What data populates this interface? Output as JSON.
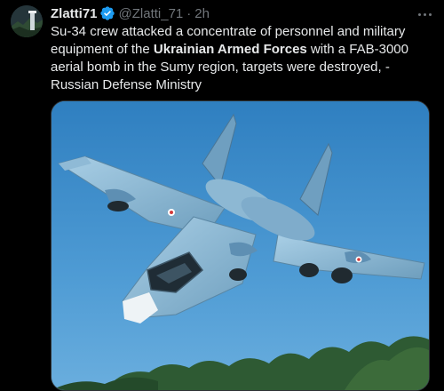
{
  "author": {
    "display_name": "Zlatti71",
    "handle": "@Zlatti_71",
    "separator": "·",
    "time": "2h",
    "verified_icon": "verified-badge-icon"
  },
  "tweet": {
    "text_part1": "Su-34 crew attacked a concentrate of personnel and military equipment of the ",
    "text_bold": "Ukrainian Armed Forces",
    "text_part2": " with a FAB-3000 aerial bomb in the Sumy region, targets were destroyed, - Russian Defense Ministry"
  },
  "media": {
    "description_icon": "fighter-jet-photo"
  },
  "colors": {
    "background": "#000000",
    "text": "#e7e9ea",
    "muted": "#71767b",
    "verified": "#1d9bf0"
  }
}
